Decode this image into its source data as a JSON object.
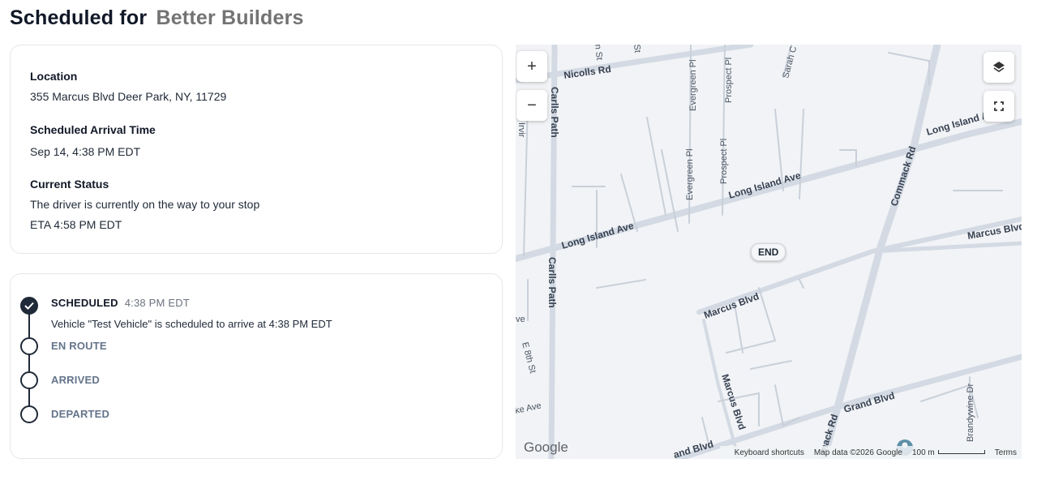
{
  "page": {
    "title_prefix": "Scheduled for",
    "company": "Better Builders"
  },
  "stop": {
    "location_label": "Location",
    "location_value": "355 Marcus Blvd Deer Park, NY, 11729",
    "arrival_label": "Scheduled Arrival Time",
    "arrival_value": "Sep 14, 4:38 PM EDT",
    "status_label": "Current Status",
    "status_value": "The driver is currently on the way to your stop",
    "eta_value": "ETA 4:58 PM EDT"
  },
  "timeline": {
    "steps": [
      {
        "label": "SCHEDULED",
        "time": "4:38 PM EDT",
        "description": "Vehicle \"Test Vehicle\" is scheduled to arrive at 4:38 PM EDT",
        "done": true
      },
      {
        "label": "EN ROUTE",
        "done": false
      },
      {
        "label": "ARRIVED",
        "done": false
      },
      {
        "label": "DEPARTED",
        "done": false
      }
    ]
  },
  "map": {
    "end_marker": "END",
    "zoom_in": "+",
    "zoom_out": "−",
    "brand": "Google",
    "keyboard_shortcuts": "Keyboard shortcuts",
    "map_data": "Map data ©2026 Google",
    "scale": "100 m",
    "terms": "Terms",
    "roads": {
      "nicolls": "Nicolls Rd",
      "carlls1": "Carlls Path",
      "carlls2": "Carlls Path",
      "long_island1": "Long Island Ave",
      "long_island2": "Long Island Ave",
      "long_island3": "Long Island Ave",
      "commack1": "Commack Rd",
      "commack2": "mack Rd",
      "marcus1": "Marcus Blvd",
      "marcus2": "Marcus Blvd",
      "marcus3": "Marcus Blvd",
      "grand": "Grand Blvd",
      "grand2": "and Blvd",
      "evergreen1": "Evergreen Pl",
      "evergreen2": "Evergreen Pl",
      "prospect1": "Prospect Pl",
      "prospect2": "Prospect Pl",
      "sarah": "Sarah C",
      "e8th": "E 8th St",
      "brandywine": "Brandywine Dr",
      "irvin": "Irvir",
      "ave1": "ve",
      "ave2": "ke Ave",
      "st1": "n St",
      "st2": "St"
    },
    "colors": {
      "background": "#f1f3f6",
      "road": "#d3dae3",
      "minor_road": "#c9d0d9"
    }
  }
}
